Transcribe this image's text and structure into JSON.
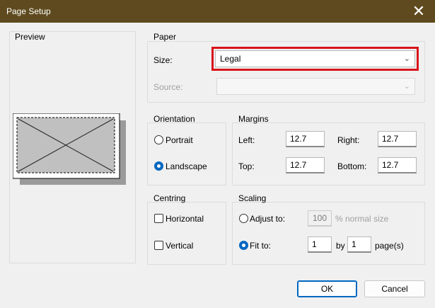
{
  "window": {
    "title": "Page Setup"
  },
  "preview": {
    "title": "Preview"
  },
  "paper": {
    "title": "Paper",
    "size_label": "Size:",
    "size_value": "Legal",
    "source_label": "Source:",
    "source_value": ""
  },
  "orientation": {
    "title": "Orientation",
    "portrait_label": "Portrait",
    "landscape_label": "Landscape",
    "selected": "Landscape"
  },
  "margins": {
    "title": "Margins",
    "left_label": "Left:",
    "left_value": "12.7",
    "right_label": "Right:",
    "right_value": "12.7",
    "top_label": "Top:",
    "top_value": "12.7",
    "bottom_label": "Bottom:",
    "bottom_value": "12.7"
  },
  "centring": {
    "title": "Centring",
    "horizontal_label": "Horizontal",
    "vertical_label": "Vertical"
  },
  "scaling": {
    "title": "Scaling",
    "adjust_label": "Adjust to:",
    "adjust_value": "100",
    "normal_size_label": "% normal size",
    "fit_label": "Fit to:",
    "fit_wide_value": "1",
    "by_label": "by",
    "fit_tall_value": "1",
    "pages_label": "page(s)",
    "selected": "Fit to"
  },
  "buttons": {
    "ok_label": "OK",
    "cancel_label": "Cancel"
  },
  "colors": {
    "titlebar": "#5e4a1e",
    "accent": "#0067c0",
    "highlight": "#d8141b"
  }
}
